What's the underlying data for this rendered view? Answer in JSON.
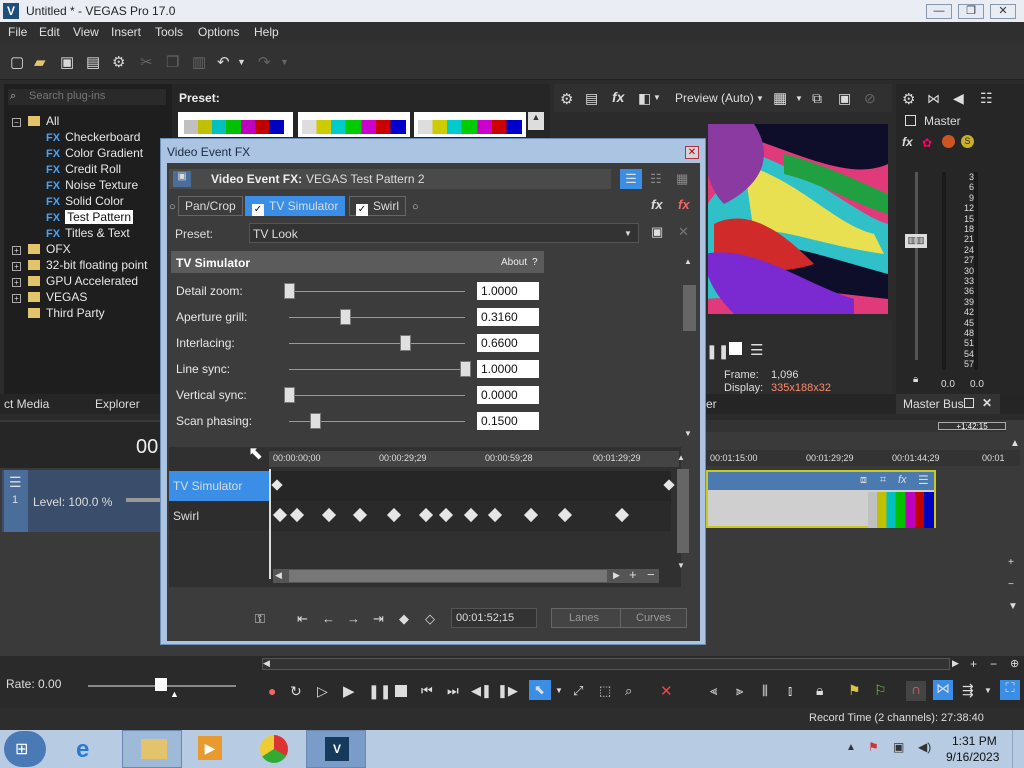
{
  "window": {
    "title": "Untitled * - VEGAS Pro 17.0",
    "app_icon": "V",
    "minimize": "—",
    "maximize": "❐",
    "close": "✕"
  },
  "menu": [
    "File",
    "Edit",
    "View",
    "Insert",
    "Tools",
    "Options",
    "Help"
  ],
  "plugins": {
    "search_placeholder": "Search plug-ins",
    "preset_label": "Preset:",
    "root": "All",
    "items": [
      "Checkerboard",
      "Color Gradient",
      "Credit Roll",
      "Noise Texture",
      "Solid Color",
      "Test Pattern",
      "Titles & Text"
    ],
    "folders": [
      "OFX",
      "32-bit floating point",
      "GPU Accelerated",
      "VEGAS",
      "Third Party"
    ],
    "fx_badge": "FX",
    "selected": "Test Pattern"
  },
  "tabs": {
    "media": "ct Media",
    "explorer": "Explorer",
    "mixer": "er",
    "master_bus": "Master Bus"
  },
  "preview": {
    "mode": "Preview (Auto)",
    "frame_label": "Frame:",
    "frame_value": "1,096",
    "display_label": "Display:",
    "display_value": "335x188x32"
  },
  "master": {
    "label": "Master",
    "scale": [
      "3",
      "6",
      "9",
      "12",
      "15",
      "18",
      "21",
      "24",
      "27",
      "30",
      "33",
      "36",
      "39",
      "42",
      "45",
      "48",
      "51",
      "54",
      "57"
    ],
    "level_left": "0.0",
    "level_right": "0.0"
  },
  "dialog": {
    "title": "Video Event FX",
    "header_label": "Video Event FX:",
    "header_value": "VEGAS Test Pattern 2",
    "chain": {
      "pancrop": "Pan/Crop",
      "tv_sim": "TV Simulator",
      "swirl": "Swirl"
    },
    "preset_label": "Preset:",
    "preset_value": "TV Look",
    "panel_title": "TV Simulator",
    "about": "About",
    "about_help": "?",
    "params": [
      {
        "label": "Detail zoom:",
        "value": "1.0000",
        "pos": 0.0
      },
      {
        "label": "Aperture grill:",
        "value": "0.3160",
        "pos": 0.316
      },
      {
        "label": "Interlacing:",
        "value": "0.6600",
        "pos": 0.66
      },
      {
        "label": "Line sync:",
        "value": "1.0000",
        "pos": 1.0
      },
      {
        "label": "Vertical sync:",
        "value": "0.0000",
        "pos": 0.0
      },
      {
        "label": "Scan phasing:",
        "value": "0.1500",
        "pos": 0.15
      }
    ],
    "ruler": [
      "00:00:00;00",
      "00:00:29;29",
      "00:00:59;28",
      "00:01:29;29"
    ],
    "tracks": [
      "TV Simulator",
      "Swirl"
    ],
    "timecode": "00:01:52;15",
    "lanes": "Lanes",
    "curves": "Curves"
  },
  "timeline": {
    "ruler": [
      "00:01:15:00",
      "00:01:29;29",
      "00:01:44;29",
      "00:01"
    ],
    "region_time": "+1:42:15",
    "level": "Level: 100.0 %",
    "track_number": "1",
    "big_timecode": "00"
  },
  "transport": {
    "rate": "Rate: 0.00"
  },
  "status": {
    "record_time": "Record Time (2 channels): 27:38:40"
  },
  "taskbar": {
    "time": "1:31 PM",
    "date": "9/16/2023",
    "vegas_label": "V"
  },
  "colors": {
    "accent": "#3a8ee6",
    "dialog_frame": "#aac4e2",
    "taskbar": "#b7cbe3"
  }
}
